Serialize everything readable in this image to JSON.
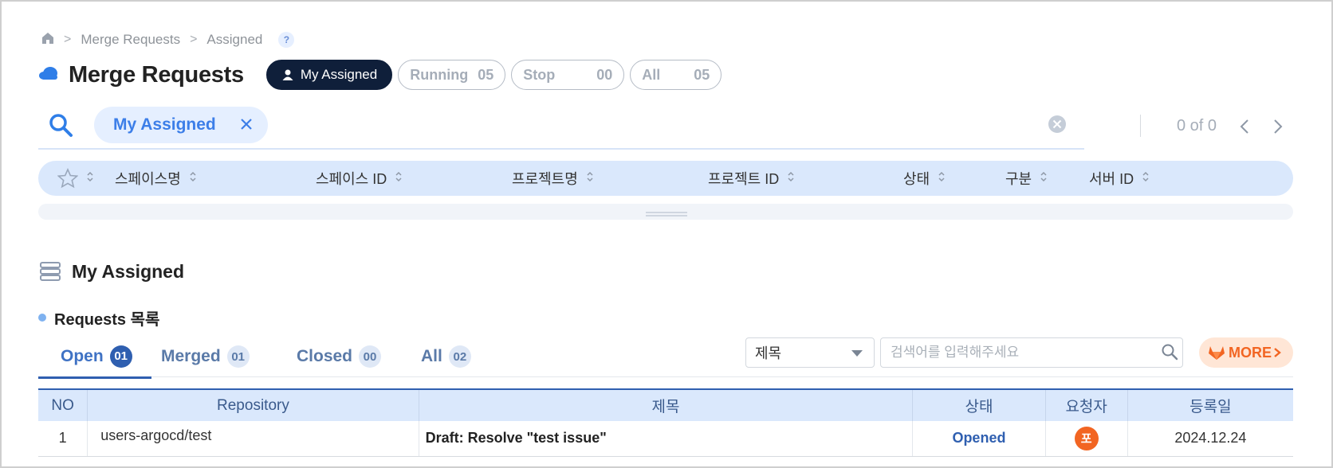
{
  "breadcrumb": {
    "home_icon": "home-icon",
    "items": [
      "Merge Requests",
      "Assigned"
    ],
    "help": "?"
  },
  "header": {
    "title": "Merge Requests",
    "logo_icon": "cloud-icon",
    "filters": [
      {
        "label": "My Assigned",
        "count": "",
        "active": true
      },
      {
        "label": "Running",
        "count": "05"
      },
      {
        "label": "Stop",
        "count": "00"
      },
      {
        "label": "All",
        "count": "05"
      }
    ]
  },
  "search": {
    "chip_label": "My Assigned",
    "pager_text": "0 of 0"
  },
  "upper_table": {
    "columns": [
      "스페이스명",
      "스페이스 ID",
      "프로젝트명",
      "프로젝트 ID",
      "상태",
      "구분",
      "서버 ID"
    ]
  },
  "section": {
    "title": "My Assigned",
    "subtitle": "Requests 목록"
  },
  "tabs": [
    {
      "label": "Open",
      "count": "01",
      "active": true
    },
    {
      "label": "Merged",
      "count": "01"
    },
    {
      "label": "Closed",
      "count": "00"
    },
    {
      "label": "All",
      "count": "02"
    }
  ],
  "toolbar": {
    "select_value": "제목",
    "search_placeholder": "검색어를 입력해주세요",
    "more_label": "MORE"
  },
  "table": {
    "headers": [
      "NO",
      "Repository",
      "제목",
      "상태",
      "요청자",
      "등록일"
    ],
    "rows": [
      {
        "no": "1",
        "repository": "users-argocd/test",
        "title": "Draft: Resolve \"test issue\"",
        "status": "Opened",
        "requester": "포",
        "date": "2024.12.24"
      }
    ]
  },
  "colors": {
    "accent": "#2f5fb0",
    "navy": "#0f1f3a",
    "header_bg": "#dae8fc",
    "orange": "#f26522"
  }
}
